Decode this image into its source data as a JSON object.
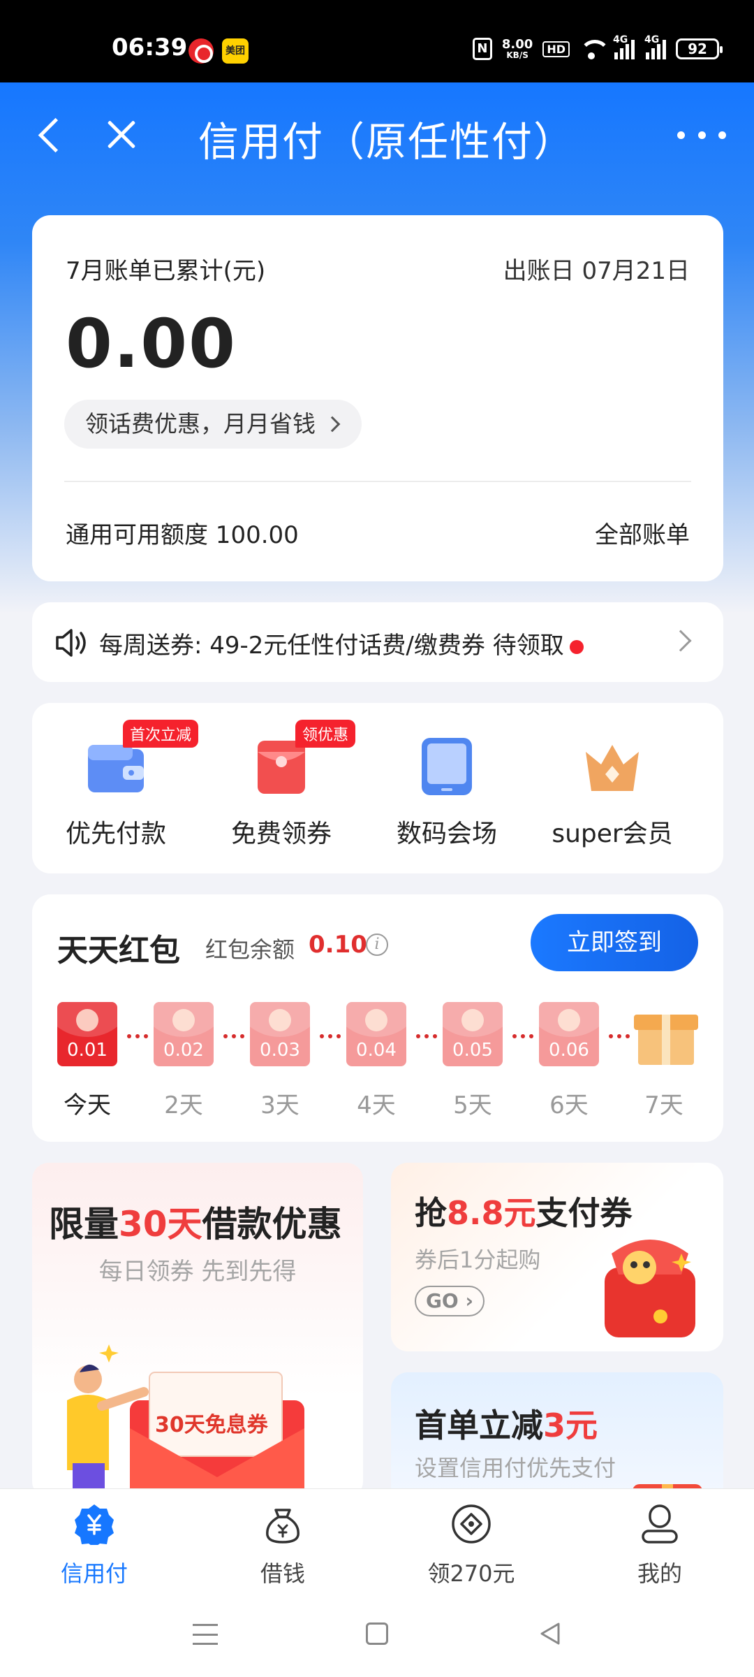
{
  "status_bar": {
    "time": "06:39",
    "net_speed_value": "8.00",
    "net_speed_unit": "KB/S",
    "hd": "HD",
    "signal1": "4G",
    "signal2": "4G",
    "battery": "92",
    "app2_label": "美团"
  },
  "nav": {
    "title": "信用付（原任性付）"
  },
  "bill": {
    "label": "7月账单已累计(元)",
    "due_date": "出账日 07月21日",
    "amount": "0.00",
    "promo": "领话费优惠，月月省钱",
    "credit_line": "通用可用额度  100.00",
    "all_bills": "全部账单"
  },
  "notice": {
    "text": "每周送券: 49-2元任性付话费/缴费券 待领取"
  },
  "quick_actions": [
    {
      "label": "优先付款",
      "badge": "首次立减",
      "icon": "wallet-icon"
    },
    {
      "label": "免费领券",
      "badge": "领优惠",
      "icon": "red-envelope-icon"
    },
    {
      "label": "数码会场",
      "badge": "",
      "icon": "tablet-icon"
    },
    {
      "label": "super会员",
      "badge": "",
      "icon": "crown-icon"
    }
  ],
  "redpack": {
    "title": "天天红包",
    "balance_label": "红包余额",
    "balance": "0.10",
    "signin": "立即签到",
    "days": [
      {
        "label": "今天",
        "amount": "0.01"
      },
      {
        "label": "2天",
        "amount": "0.02"
      },
      {
        "label": "3天",
        "amount": "0.03"
      },
      {
        "label": "4天",
        "amount": "0.04"
      },
      {
        "label": "5天",
        "amount": "0.05"
      },
      {
        "label": "6天",
        "amount": "0.06"
      },
      {
        "label": "7天",
        "amount": ""
      }
    ]
  },
  "promos": {
    "left": {
      "title_pre": "限量",
      "title_hl": "30天",
      "title_post": "借款优惠",
      "sub": "每日领券 先到先得",
      "coupon": "30天免息券"
    },
    "right1": {
      "title_pre": "抢",
      "title_hl": "8.8元",
      "title_post": "支付券",
      "sub": "券后1分起购",
      "go": "GO"
    },
    "right2": {
      "title_pre": "首单立减",
      "title_hl": "3元",
      "sub": "设置信用付优先支付"
    }
  },
  "tabs": [
    {
      "label": "信用付",
      "icon": "credit-pay-icon",
      "active": true
    },
    {
      "label": "借钱",
      "icon": "money-bag-icon",
      "active": false
    },
    {
      "label": "领270元",
      "icon": "diamond-coin-icon",
      "active": false
    },
    {
      "label": "我的",
      "icon": "profile-icon",
      "active": false
    }
  ],
  "colors": {
    "brand_blue": "#1677ff",
    "accent_red": "#e02e2e"
  }
}
